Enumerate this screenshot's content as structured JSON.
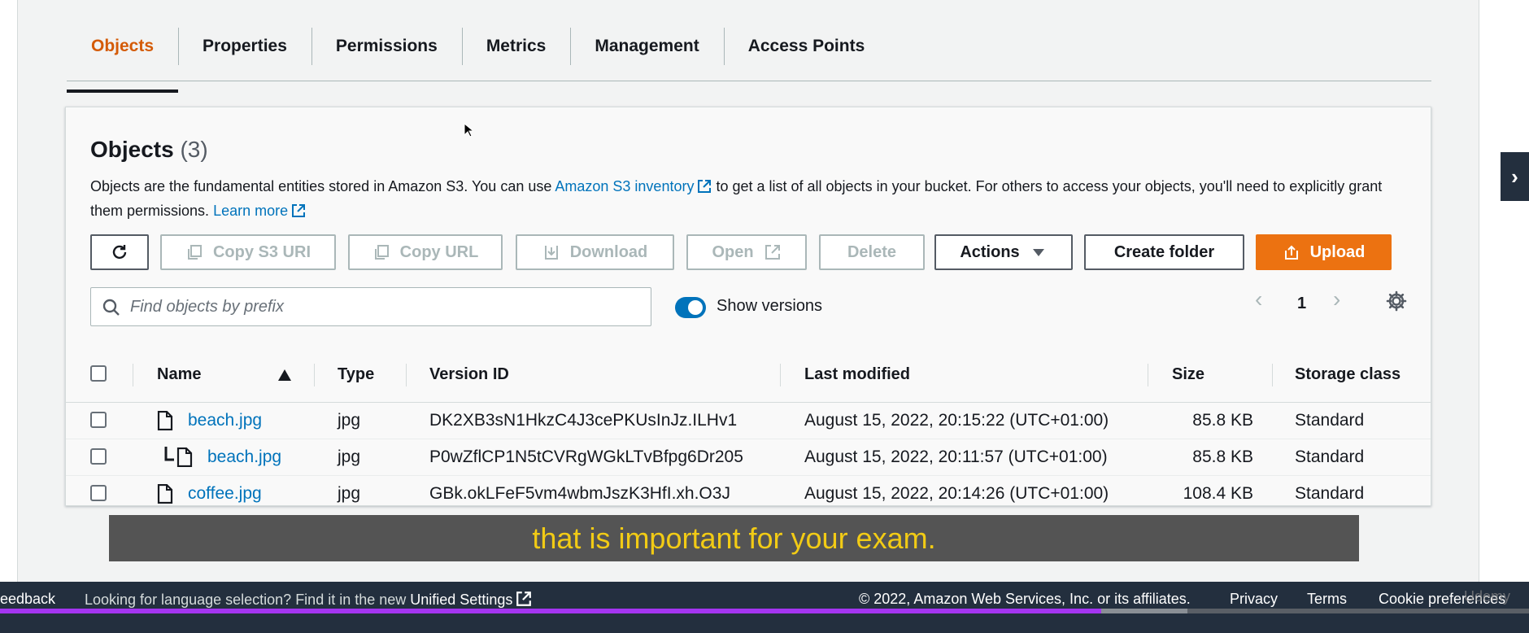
{
  "tabs": [
    {
      "label": "Objects",
      "active": true
    },
    {
      "label": "Properties"
    },
    {
      "label": "Permissions"
    },
    {
      "label": "Metrics"
    },
    {
      "label": "Management"
    },
    {
      "label": "Access Points"
    }
  ],
  "objects": {
    "title": "Objects",
    "count": "(3)",
    "desc_1": "Objects are the fundamental entities stored in Amazon S3. You can use ",
    "inventory_link": "Amazon S3 inventory",
    "desc_2": " to get a list of all objects in your bucket. For others to access your objects, you'll need to explicitly grant them permissions. ",
    "learn_more": "Learn more"
  },
  "toolbar": {
    "copy_s3_uri": "Copy S3 URI",
    "copy_url": "Copy URL",
    "download": "Download",
    "open": "Open",
    "delete": "Delete",
    "actions": "Actions",
    "create_folder": "Create folder",
    "upload": "Upload"
  },
  "search": {
    "placeholder": "Find objects by prefix"
  },
  "show_versions": {
    "label": "Show versions",
    "on": true
  },
  "pagination": {
    "page": "1"
  },
  "table": {
    "headers": {
      "name": "Name",
      "type": "Type",
      "version_id": "Version ID",
      "last_modified": "Last modified",
      "size": "Size",
      "storage_class": "Storage class"
    },
    "rows": [
      {
        "name": "beach.jpg",
        "type": "jpg",
        "version_id": "DK2XB3sN1HkzC4J3cePKUsInJz.ILHv1",
        "last_modified": "August 15, 2022, 20:15:22 (UTC+01:00)",
        "size": "85.8 KB",
        "storage_class": "Standard"
      },
      {
        "name": "beach.jpg",
        "type": "jpg",
        "version_id": "P0wZflCP1N5tCVRgWGkLTvBfpg6Dr205",
        "last_modified": "August 15, 2022, 20:11:57 (UTC+01:00)",
        "size": "85.8 KB",
        "storage_class": "Standard"
      },
      {
        "name": "coffee.jpg",
        "type": "jpg",
        "version_id": "GBk.okLFeF5vm4wbmJszK3HfI.xh.O3J",
        "last_modified": "August 15, 2022, 20:14:26 (UTC+01:00)",
        "size": "108.4 KB",
        "storage_class": "Standard"
      }
    ]
  },
  "caption": "that is important for your exam.",
  "footer": {
    "feedback": "eedback",
    "language_prefix": "Looking for language selection? Find it in the new ",
    "unified_settings": "Unified Settings",
    "copyright": "© 2022, Amazon Web Services, Inc. or its affiliates.",
    "privacy": "Privacy",
    "terms": "Terms",
    "cookie": "Cookie preferences"
  },
  "video_progress": 0.72,
  "watermark": "Udemy",
  "colors": {
    "accent": "#d45b07",
    "link": "#0073bb",
    "primary_button": "#ec7211",
    "footer_bg": "#232f3e",
    "caption_text": "#f2cb15"
  }
}
